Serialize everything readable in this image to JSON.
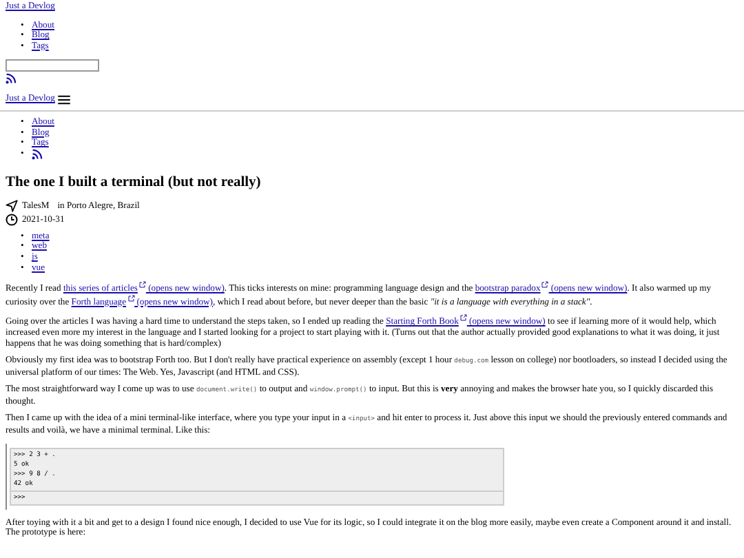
{
  "header": {
    "site_title": "Just a Devlog",
    "nav": [
      {
        "marker": "•",
        "label": "About"
      },
      {
        "marker": "•",
        "label": "Blog"
      },
      {
        "marker": "•",
        "label": "Tags"
      }
    ]
  },
  "mobile_header": {
    "site_title": "Just a Devlog",
    "nav": [
      {
        "marker": "•",
        "kind": "link",
        "label": "About"
      },
      {
        "marker": "•",
        "kind": "link",
        "label": "Blog"
      },
      {
        "marker": "•",
        "kind": "link",
        "label": "Tags"
      },
      {
        "marker": "•",
        "kind": "rss"
      }
    ]
  },
  "article": {
    "title": "The one I built a terminal (but not really)",
    "author": "TalesM",
    "location": "in Porto Alegre, Brazil",
    "date": "2021-10-31",
    "tags": [
      {
        "marker": "•",
        "label": "meta"
      },
      {
        "marker": "•",
        "label": "web"
      },
      {
        "marker": "•",
        "label": "js"
      },
      {
        "marker": "•",
        "label": "vue"
      }
    ],
    "paragraphs": [
      [
        {
          "kind": "text",
          "text": "Recently I read "
        },
        {
          "kind": "link",
          "text": "this series of articles",
          "note": "(opens new window)"
        },
        {
          "kind": "text",
          "text": ". This ticks interests on mine: programming language design and the "
        },
        {
          "kind": "link",
          "text": "bootstrap paradox",
          "note": "(opens new window)"
        },
        {
          "kind": "text",
          "text": ". It also warmed up my curiosity over the "
        },
        {
          "kind": "link",
          "text": "Forth language",
          "note": "(opens new window)"
        },
        {
          "kind": "text",
          "text": ", which I read about before, but never deeper than the basic "
        },
        {
          "kind": "italic",
          "text": "\"it is a language with everything in a stack\""
        },
        {
          "kind": "text",
          "text": "."
        }
      ],
      [
        {
          "kind": "text",
          "text": "Going over the articles I was having a hard time to understand the steps taken, so I ended up reading the "
        },
        {
          "kind": "link",
          "text": "Starting Forth Book",
          "note": "(opens new window)"
        },
        {
          "kind": "text",
          "text": " to see if learning more of it would help, which increased even more my interest in the language and I started looking for a project to start playing with it. (Turns out that the author actually provided good explanations to what it was doing, it just happens that he was doing something that is hard/complex)"
        }
      ],
      [
        {
          "kind": "text",
          "text": "Obviously my first idea was to bootstrap Forth too. But I don't really have practical experience on assembly (except 1 hour "
        },
        {
          "kind": "code",
          "text": "debug.com"
        },
        {
          "kind": "text",
          "text": " lesson on college) nor bootloaders, so instead I decided using the universal platform of our times: The Web. Yes, Javascript (and HTML and CSS)."
        }
      ],
      [
        {
          "kind": "text",
          "text": "The most straightforward way I come up was to use "
        },
        {
          "kind": "code",
          "text": "document.write()"
        },
        {
          "kind": "text",
          "text": " to output and "
        },
        {
          "kind": "code",
          "text": "window.prompt()"
        },
        {
          "kind": "text",
          "text": " to input. But this is "
        },
        {
          "kind": "bold",
          "text": "very"
        },
        {
          "kind": "text",
          "text": " annoying and makes the browser hate you, so I quickly discarded this thought."
        }
      ],
      [
        {
          "kind": "text",
          "text": "Then I came up with the idea of a mini terminal-like interface, where you type your input in a "
        },
        {
          "kind": "code",
          "text": "<input>"
        },
        {
          "kind": "text",
          "text": " and hit enter to process it. Just above this input we should the previously entered commands and results and voilà, we have a minimal terminal. Like this:"
        }
      ]
    ],
    "terminal": {
      "lines": [
        ">>> 2 3 + .",
        "5 ok",
        ">>> 9 8 / .",
        "42 ok"
      ],
      "prompt": ">>>"
    },
    "after": [
      {
        "kind": "text",
        "text": "After toying with it a bit and get to a design I found nice enough, I decided to use Vue for its logic, so I could integrate it on the blog more easily, maybe even create a Component around it and install. The prototype is here:"
      }
    ]
  }
}
